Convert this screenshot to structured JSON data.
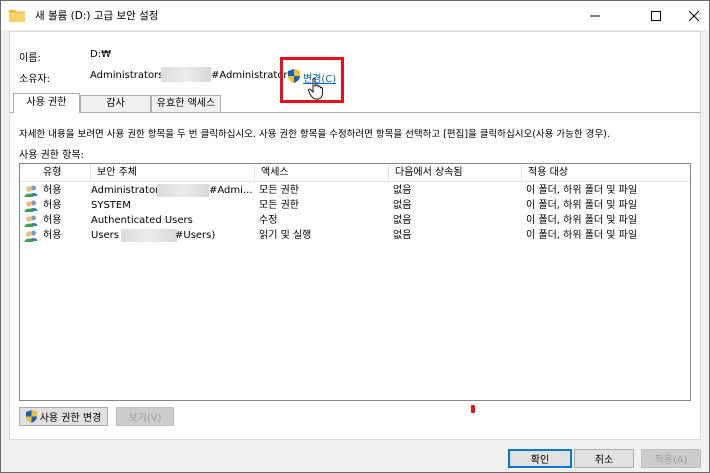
{
  "window": {
    "title": "새 볼륨 (D:) 고급 보안 설정",
    "minimize_icon": "minimize-icon",
    "maximize_icon": "maximize-icon",
    "close_icon": "close-icon"
  },
  "header": {
    "name_label": "이름:",
    "name_value": "D:₩",
    "owner_label": "소유자:",
    "owner_value_start": "Administrators (",
    "owner_value_end": "#Administrators)",
    "change_link": "변경(C)"
  },
  "tabs": [
    {
      "label": "사용 권한",
      "active": true
    },
    {
      "label": "감사",
      "active": false
    },
    {
      "label": "유효한 액세스",
      "active": false
    }
  ],
  "permissions": {
    "instructions": "자세한 내용을 보려면 사용 권한 항목을 두 번 클릭하십시오. 사용 권한 항목을 수정하려면 항목을 선택하고 [편집]을 클릭하십시오(사용 가능한 경우).",
    "entries_label": "사용 권한 항목:",
    "columns": [
      "유형",
      "보안 주체",
      "액세스",
      "다음에서 상속됨",
      "적용 대상"
    ],
    "rows": [
      {
        "type": "허용",
        "principal_start": "Administrators",
        "principal_end": "#Admi...",
        "access": "모든 권한",
        "inherited": "없음",
        "applies": "이 폴더, 하위 폴더 및 파일"
      },
      {
        "type": "허용",
        "principal_start": "SYSTEM",
        "principal_end": "",
        "access": "모든 권한",
        "inherited": "없음",
        "applies": "이 폴더, 하위 폴더 및 파일"
      },
      {
        "type": "허용",
        "principal_start": "Authenticated Users",
        "principal_end": "",
        "access": "수정",
        "inherited": "없음",
        "applies": "이 폴더, 하위 폴더 및 파일"
      },
      {
        "type": "허용",
        "principal_start": "Users (",
        "principal_end": "#Users)",
        "access": "읽기 및 실행",
        "inherited": "없음",
        "applies": "이 폴더, 하위 폴더 및 파일"
      }
    ],
    "change_permissions_button": "사용 권한 변경",
    "view_button": "보기(V)"
  },
  "footer": {
    "ok": "확인",
    "cancel": "취소",
    "apply": "적용(A)"
  },
  "colors": {
    "accent_link": "#0066cc",
    "highlight_box": "#e8101a",
    "default_button_border": "#0078d7"
  }
}
